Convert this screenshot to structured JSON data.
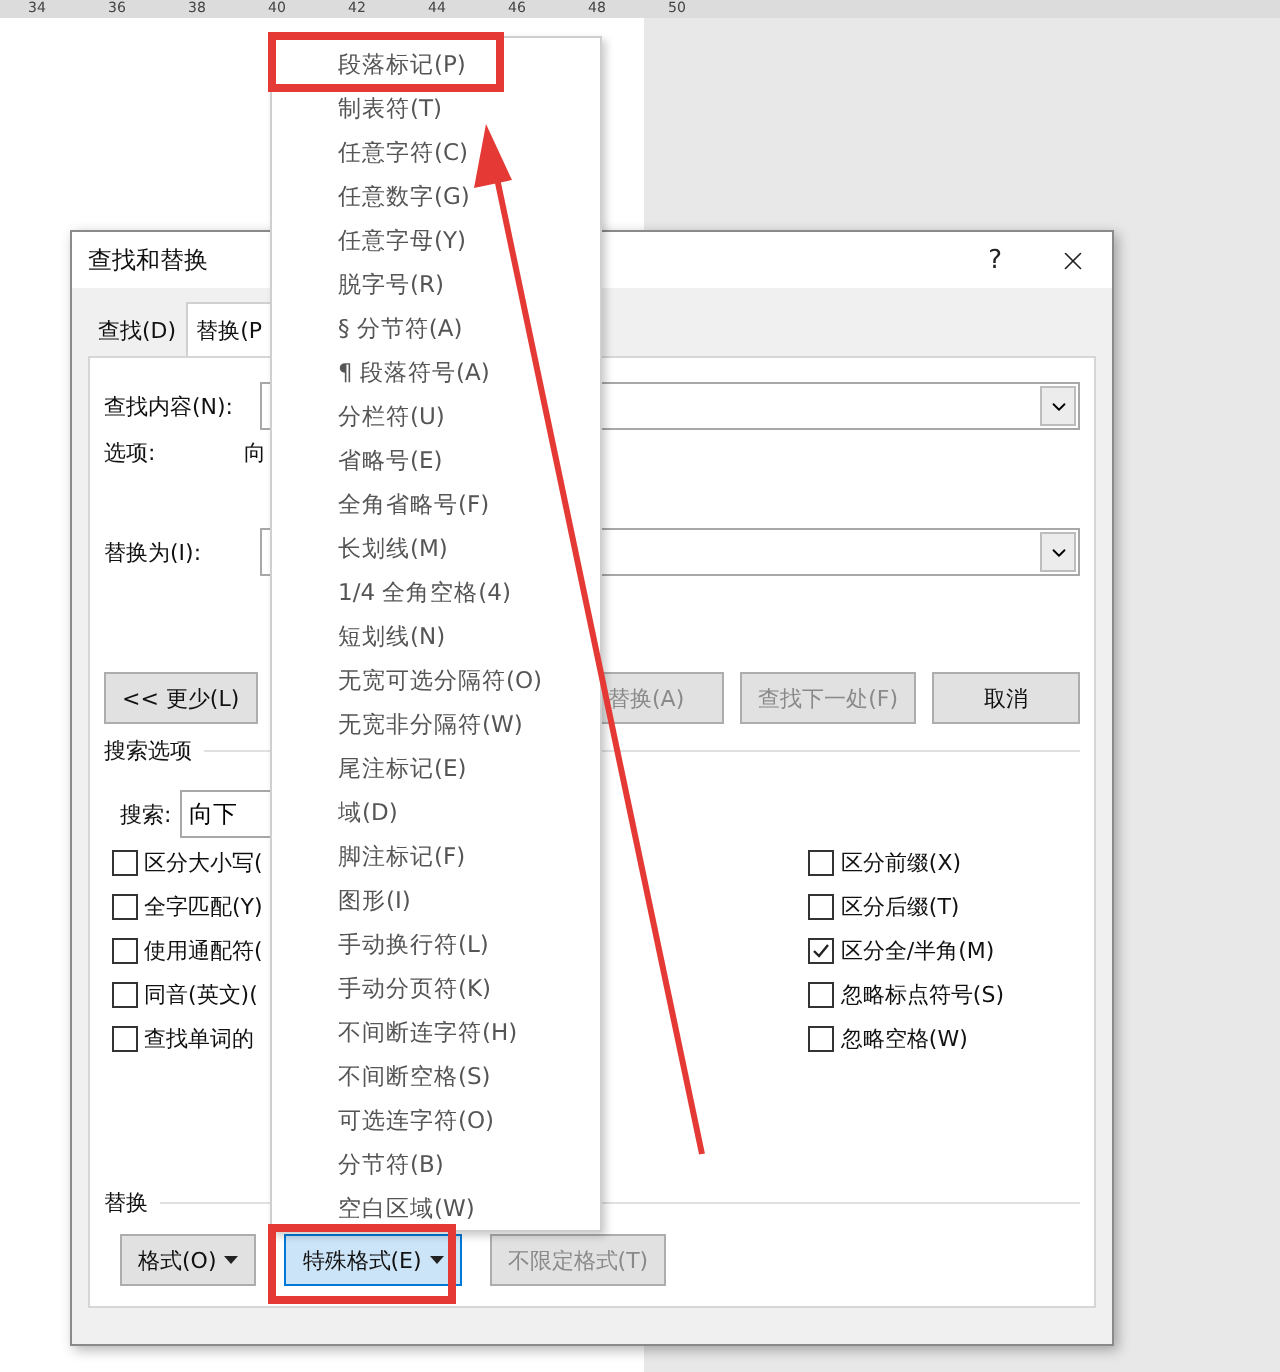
{
  "ruler": {
    "labels": [
      "34",
      "36",
      "38",
      "40",
      "42",
      "44",
      "46",
      "48",
      "50"
    ]
  },
  "dialog": {
    "title": "查找和替换",
    "help": "?",
    "tabs": [
      {
        "label": "查找(D)",
        "selected": false
      },
      {
        "label": "替换(P",
        "selected": true
      }
    ],
    "find": {
      "label": "查找内容(N):"
    },
    "options": {
      "label": "选项:",
      "value": "向"
    },
    "replace": {
      "label": "替换为(I):"
    },
    "less_button": {
      "label": "<< 更少(L)",
      "disabled": false
    },
    "buttons": [
      {
        "label": "替换(A)",
        "disabled": true
      },
      {
        "label": "查找下一处(F)",
        "disabled": true
      },
      {
        "label": "取消",
        "disabled": false
      }
    ],
    "search_options": {
      "title": "搜索选项",
      "search_label": "搜索:",
      "search_value": "向下",
      "left_checks": [
        {
          "label": "区分大小写(",
          "checked": false
        },
        {
          "label": "全字匹配(Y)",
          "checked": false
        },
        {
          "label": "使用通配符(",
          "checked": false
        },
        {
          "label": "同音(英文)(",
          "checked": false
        },
        {
          "label": "查找单词的",
          "checked": false
        }
      ],
      "right_checks": [
        {
          "label": "区分前缀(X)",
          "checked": false
        },
        {
          "label": "区分后缀(T)",
          "checked": false
        },
        {
          "label": "区分全/半角(M)",
          "checked": true
        },
        {
          "label": "忽略标点符号(S)",
          "checked": false
        },
        {
          "label": "忽略空格(W)",
          "checked": false
        }
      ]
    },
    "replace_section": {
      "title": "替换",
      "buttons": [
        {
          "label": "格式(O)",
          "focused": false,
          "disabled": false,
          "caret": true
        },
        {
          "label": "特殊格式(E)",
          "focused": true,
          "disabled": false,
          "caret": true
        },
        {
          "label": "不限定格式(T)",
          "focused": false,
          "disabled": true,
          "caret": false
        }
      ]
    }
  },
  "menu": {
    "items": [
      "段落标记(P)",
      "制表符(T)",
      "任意字符(C)",
      "任意数字(G)",
      "任意字母(Y)",
      "脱字号(R)",
      "§ 分节符(A)",
      "¶ 段落符号(A)",
      "分栏符(U)",
      "省略号(E)",
      "全角省略号(F)",
      "长划线(M)",
      "1/4 全角空格(4)",
      "短划线(N)",
      "无宽可选分隔符(O)",
      "无宽非分隔符(W)",
      "尾注标记(E)",
      "域(D)",
      "脚注标记(F)",
      "图形(I)",
      "手动换行符(L)",
      "手动分页符(K)",
      "不间断连字符(H)",
      "不间断空格(S)",
      "可选连字符(O)",
      "分节符(B)",
      "空白区域(W)"
    ]
  }
}
